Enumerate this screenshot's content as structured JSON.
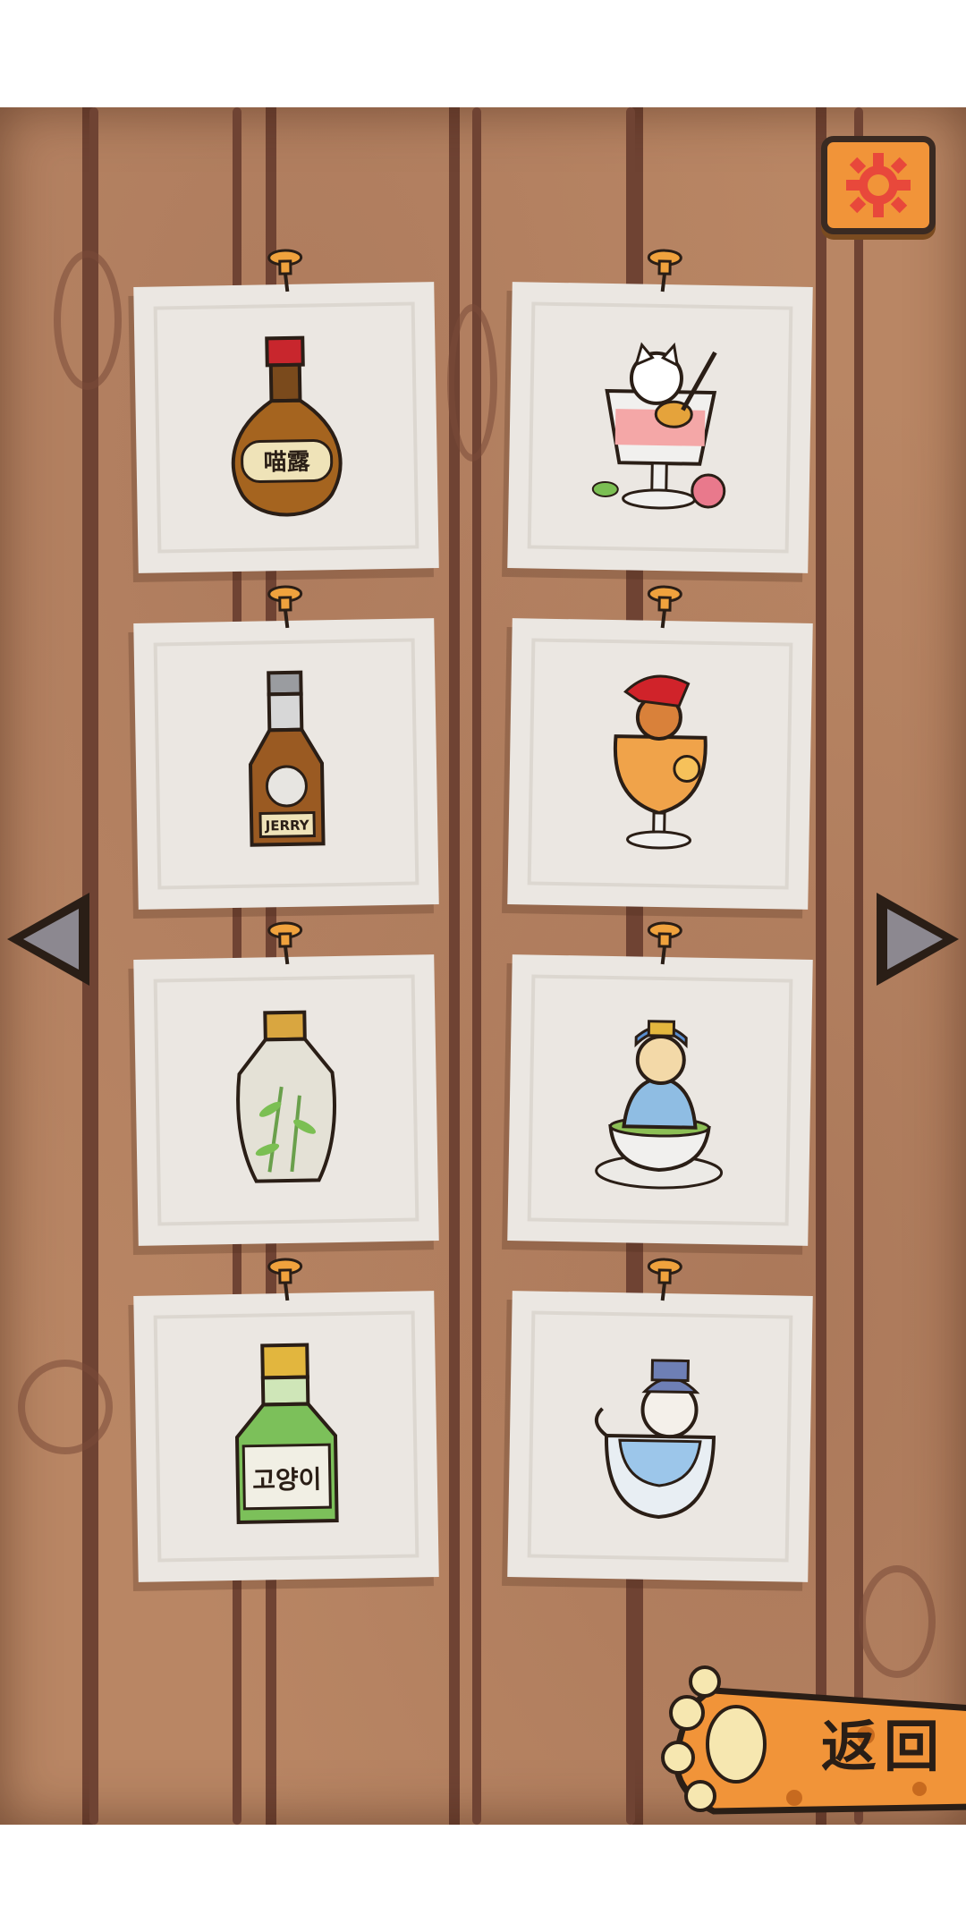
{
  "colors": {
    "board": "#b98664",
    "board_line": "#6f4333",
    "card": "#ebe7e2",
    "pin": "#f0a23d",
    "accent_orange": "#f19439",
    "gear": "#e8483b",
    "arrow": "#8c8890"
  },
  "toolbar": {
    "settings_icon": "gear-icon"
  },
  "navigation": {
    "prev_icon": "triangle-left-icon",
    "next_icon": "triangle-right-icon"
  },
  "cards": [
    {
      "id": "card-1",
      "item": "bottle-amber",
      "label": "喵露"
    },
    {
      "id": "card-2",
      "item": "cat-dessert-pink-guitar"
    },
    {
      "id": "card-3",
      "item": "bottle-whisky-cat",
      "label": "JERRY"
    },
    {
      "id": "card-4",
      "item": "cat-orange-drink-red-hat"
    },
    {
      "id": "card-5",
      "item": "bottle-white-bamboo"
    },
    {
      "id": "card-6",
      "item": "cat-green-tea-cup"
    },
    {
      "id": "card-7",
      "item": "bottle-green-soju",
      "label": "고양이"
    },
    {
      "id": "card-8",
      "item": "cat-blue-bowl-hat"
    }
  ],
  "back_button": {
    "label": "返回",
    "icon": "paw-icon"
  }
}
